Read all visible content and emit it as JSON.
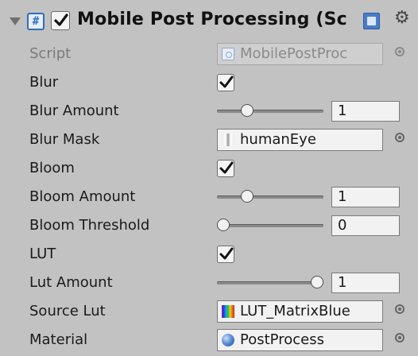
{
  "component": {
    "title": "Mobile Post Processing (Sc",
    "enabled": true
  },
  "icons": {
    "header_script": "script-icon",
    "help": "help-book-icon",
    "settings": "gear-icon",
    "object_picker": "target-icon"
  },
  "fields": {
    "script": {
      "label": "Script",
      "value": "MobilePostProc"
    },
    "blur": {
      "label": "Blur",
      "checked": true
    },
    "blur_amount": {
      "label": "Blur Amount",
      "value": "1",
      "fraction": 0.25
    },
    "blur_mask": {
      "label": "Blur Mask",
      "value": "humanEye"
    },
    "bloom": {
      "label": "Bloom",
      "checked": true
    },
    "bloom_amount": {
      "label": "Bloom Amount",
      "value": "1",
      "fraction": 0.25
    },
    "bloom_threshold": {
      "label": "Bloom Threshold",
      "value": "0",
      "fraction": 0.0
    },
    "lut": {
      "label": "LUT",
      "checked": true
    },
    "lut_amount": {
      "label": "Lut Amount",
      "value": "1",
      "fraction": 1.0
    },
    "source_lut": {
      "label": "Source Lut",
      "value": "LUT_MatrixBlue"
    },
    "material": {
      "label": "Material",
      "value": "PostProcess"
    }
  },
  "colors": {
    "panel_bg": "#c2c2c2",
    "accent": "#2d6ec6"
  }
}
